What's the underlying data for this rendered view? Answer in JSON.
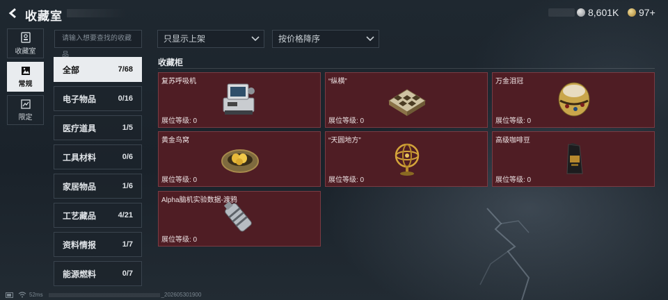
{
  "header": {
    "title": "收藏室",
    "currency_silver": "8,601K",
    "currency_gold": "97+"
  },
  "leftnav": [
    {
      "label": "收藏室",
      "icon": "collection-room-icon",
      "active": false
    },
    {
      "label": "常规",
      "icon": "regular-icon",
      "active": true
    },
    {
      "label": "限定",
      "icon": "limited-icon",
      "active": false
    }
  ],
  "search": {
    "placeholder": "请输入想要查找的收藏品"
  },
  "filters": {
    "shelf": "只显示上架",
    "sort": "按价格降序"
  },
  "categories": [
    {
      "name": "全部",
      "count": "7/68",
      "active": true
    },
    {
      "name": "电子物品",
      "count": "0/16",
      "active": false
    },
    {
      "name": "医疗道具",
      "count": "1/5",
      "active": false
    },
    {
      "name": "工具材料",
      "count": "0/6",
      "active": false
    },
    {
      "name": "家居物品",
      "count": "1/6",
      "active": false
    },
    {
      "name": "工艺藏品",
      "count": "4/21",
      "active": false
    },
    {
      "name": "资料情报",
      "count": "1/7",
      "active": false
    },
    {
      "name": "能源燃料",
      "count": "0/7",
      "active": false
    }
  ],
  "cabinet": {
    "label": "收藏柜",
    "items": [
      {
        "name": "复苏呼吸机",
        "level": "展位等级: 0",
        "icon": "ventilator-icon"
      },
      {
        "name": "“纵横”",
        "level": "展位等级: 0",
        "icon": "chess-board-icon"
      },
      {
        "name": "万金泪冠",
        "level": "展位等级: 0",
        "icon": "jeweled-egg-icon"
      },
      {
        "name": "黄金鸟窝",
        "level": "展位等级: 0",
        "icon": "golden-nest-icon"
      },
      {
        "name": "“天圆地方”",
        "level": "展位等级: 0",
        "icon": "armillary-sphere-icon"
      },
      {
        "name": "高级咖啡豆",
        "level": "展位等级: 0",
        "icon": "coffee-bag-icon"
      },
      {
        "name": "Alpha脑机实验数据-渡鸦",
        "level": "展位等级: 0",
        "icon": "data-canister-icon"
      }
    ]
  },
  "status": {
    "ping": "52ms",
    "build": "_202605301900"
  }
}
